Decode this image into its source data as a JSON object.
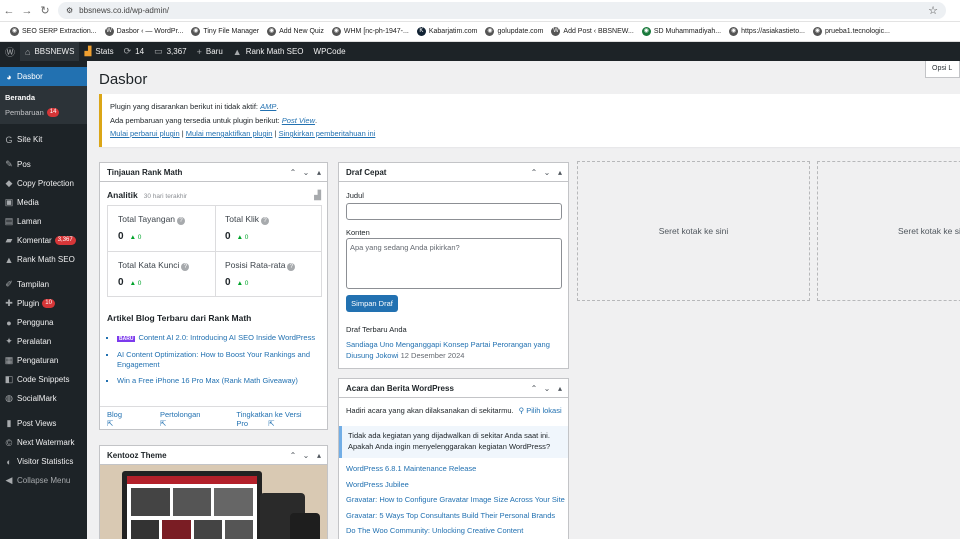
{
  "browser": {
    "url": "bbsnews.co.id/wp-admin/",
    "bookmarks": [
      "SEO SERP Extraction...",
      "Dasbor ‹ — WordPr...",
      "Tiny File Manager",
      "Add New Quiz",
      "WHM [nc-ph-1947-...",
      "Kabarjatim.com",
      "golupdate.com",
      "Add Post ‹ BBSNEW...",
      "SD Muhammadiyah...",
      "https://asiakastieto...",
      "prueba1.tecnologic..."
    ]
  },
  "adminbar": {
    "site": "BBSNEWS",
    "stats": "Stats",
    "updates": "14",
    "comments": "3,367",
    "new": "Baru",
    "rankmath": "Rank Math SEO",
    "wpcode": "WPCode"
  },
  "sidebar": {
    "dashboard": "Dasbor",
    "sub_home": "Beranda",
    "sub_updates": "Pembaruan",
    "sub_updates_badge": "14",
    "items": [
      {
        "label": "Site Kit",
        "icon": "G"
      },
      {
        "label": "Pos",
        "icon": "✎"
      },
      {
        "label": "Copy Protection",
        "icon": "◆"
      },
      {
        "label": "Media",
        "icon": "▣"
      },
      {
        "label": "Laman",
        "icon": "▤"
      },
      {
        "label": "Komentar",
        "icon": "▰",
        "badge": "3,367"
      },
      {
        "label": "Rank Math SEO",
        "icon": "▲"
      },
      {
        "label": "Tampilan",
        "icon": "✐"
      },
      {
        "label": "Plugin",
        "icon": "✚",
        "badge": "10"
      },
      {
        "label": "Pengguna",
        "icon": "●"
      },
      {
        "label": "Peralatan",
        "icon": "✦"
      },
      {
        "label": "Pengaturan",
        "icon": "▦"
      },
      {
        "label": "Code Snippets",
        "icon": "◧"
      },
      {
        "label": "SocialMark",
        "icon": "◍"
      },
      {
        "label": "Post Views",
        "icon": "▮"
      },
      {
        "label": "Next Watermark",
        "icon": "©"
      },
      {
        "label": "Visitor Statistics",
        "icon": "◐"
      },
      {
        "label": "Collapse Menu",
        "icon": "◀"
      }
    ]
  },
  "page": {
    "title": "Dasbor",
    "screen_options": "Opsi L"
  },
  "notice": {
    "line1_prefix": "Plugin yang disarankan berikut ini tidak aktif:",
    "line1_link": "AMP",
    "line1_suffix": ".",
    "line2_prefix": "Ada pembaruan yang tersedia untuk plugin berikut:",
    "line2_link": "Post View",
    "line2_suffix": ".",
    "action1": "Mulai perbarui plugin",
    "action2": "Mulai mengaktifkan plugin",
    "action3": "Singkirkan pemberitahuan ini",
    "sep": "|"
  },
  "rankmath": {
    "title": "Tinjauan Rank Math",
    "analytics": "Analitik",
    "period": "30 hari terakhir",
    "stats": [
      {
        "label": "Total Tayangan",
        "value": "0",
        "delta": "▲ 0"
      },
      {
        "label": "Total Klik",
        "value": "0",
        "delta": "▲ 0"
      },
      {
        "label": "Total Kata Kunci",
        "value": "0",
        "delta": "▲ 0"
      },
      {
        "label": "Posisi Rata-rata",
        "value": "0",
        "delta": "▲ 0"
      }
    ],
    "blog_title": "Artikel Blog Terbaru dari Rank Math",
    "new_badge": "BARU",
    "articles": [
      "Content AI 2.0: Introducing AI SEO Inside WordPress",
      "AI Content Optimization: How to Boost Your Rankings and Engagement",
      "Win a Free iPhone 16 Pro Max (Rank Math Giveaway)"
    ],
    "footer": {
      "blog": "Blog",
      "help": "Pertolongan",
      "pro": "Tingkatkan ke Versi Pro"
    }
  },
  "kentooz": {
    "title": "Kentooz Theme"
  },
  "draft": {
    "title": "Draf Cepat",
    "title_label": "Judul",
    "content_label": "Konten",
    "content_placeholder": "Apa yang sedang Anda pikirkan?",
    "save": "Simpan Draf",
    "recent_heading": "Draf Terbaru Anda",
    "recent_link": "Sandiaga Uno Menganggapi Konsep Partai Perorangan yang Diusung Jokowi",
    "recent_date": "12 Desember 2024"
  },
  "events": {
    "title": "Acara dan Berita WordPress",
    "intro": "Hadiri acara yang akan dilaksanakan di sekitarmu.",
    "location": "Pilih lokasi",
    "no_events": "Tidak ada kegiatan yang dijadwalkan di sekitar Anda saat ini. Apakah Anda ingin",
    "no_events_link": "menyelenggarakan kegiatan WordPress",
    "no_events_end": "?",
    "news": [
      "WordPress 6.8.1 Maintenance Release",
      "WordPress Jubilee",
      "Gravatar: How to Configure Gravatar Image Size Across Your Site",
      "Gravatar: 5 Ways Top Consultants Build Their Personal Brands",
      "Do The Woo Community: Unlocking Creative Content Management"
    ]
  },
  "dropzones": [
    "Seret kotak ke sini",
    "Seret kotak ke sini"
  ],
  "colors": {
    "admin_bar": "#1d2327",
    "accent": "#2271b1",
    "badge": "#d63638",
    "notice_border": "#dba617"
  }
}
